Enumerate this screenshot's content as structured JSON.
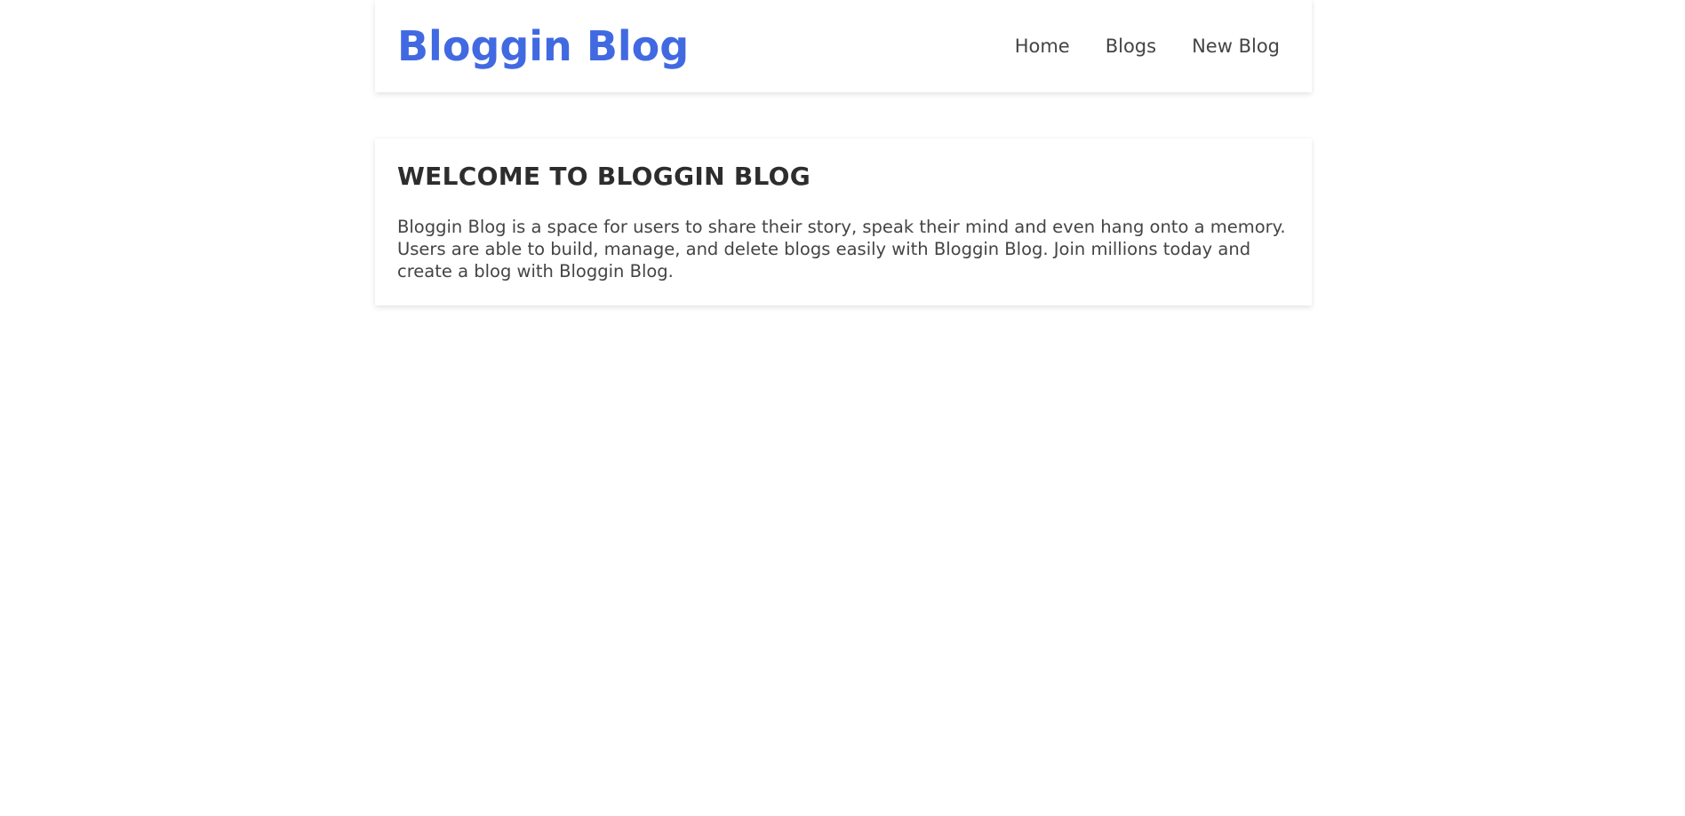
{
  "navbar": {
    "brand": "Bloggin Blog",
    "links": [
      {
        "label": "Home"
      },
      {
        "label": "Blogs"
      },
      {
        "label": "New Blog"
      }
    ]
  },
  "welcome": {
    "title": "WELCOME TO BLOGGIN BLOG",
    "body": "Bloggin Blog is a space for users to share their story, speak their mind and even hang onto a memory. Users are able to build, manage, and delete blogs easily with Bloggin Blog. Join millions today and create a blog with Bloggin Blog."
  },
  "colors": {
    "brand": "#4169e1",
    "text": "#444444",
    "heading": "#2d2d2d",
    "background": "#ffffff"
  }
}
